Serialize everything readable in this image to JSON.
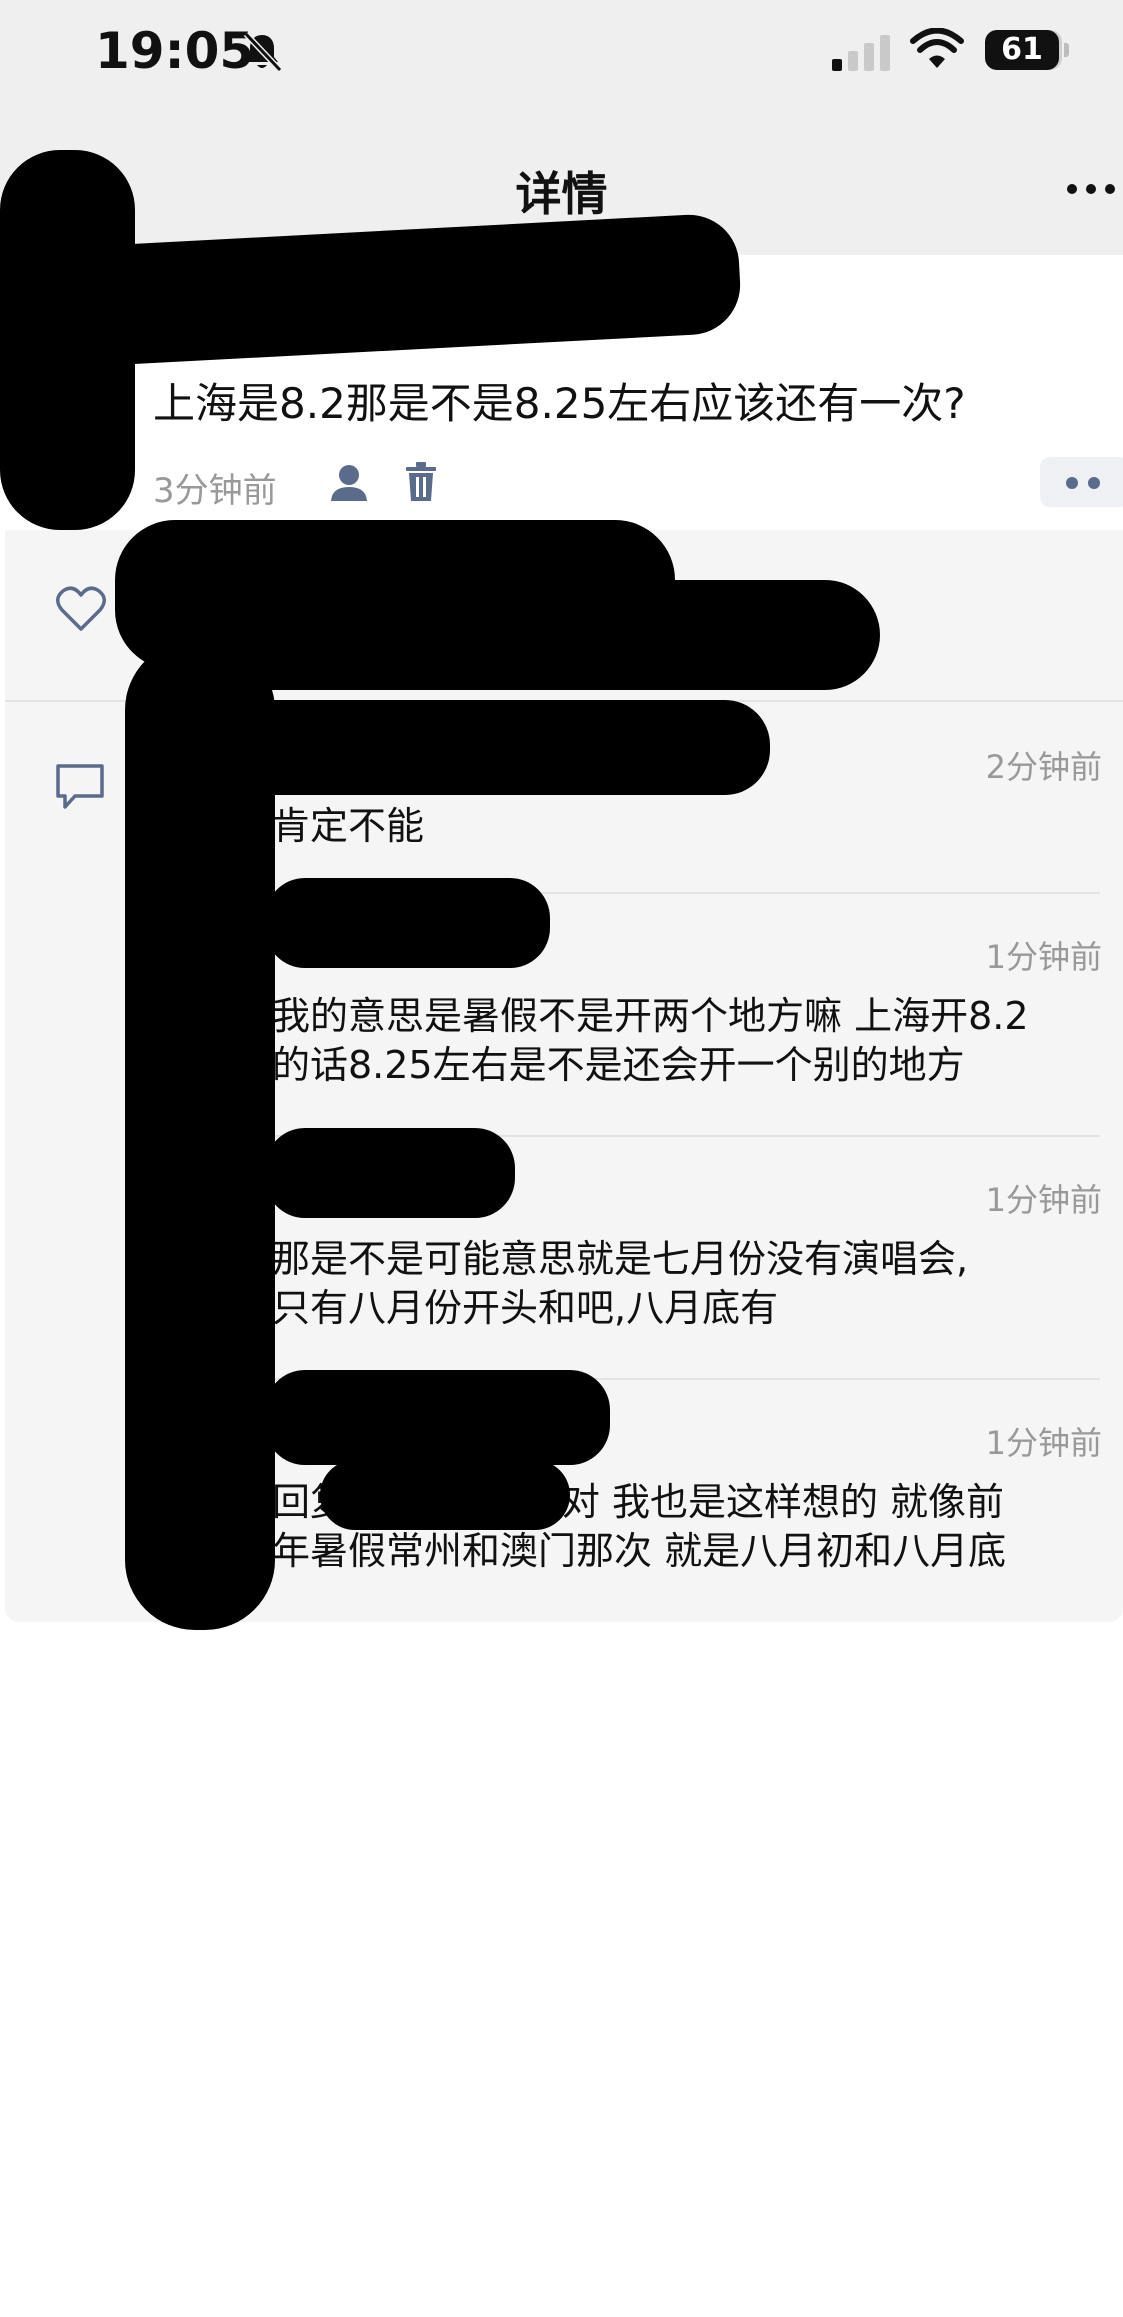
{
  "status_bar": {
    "time": "19:05",
    "battery": "61",
    "icons": [
      "bell-off-icon",
      "signal-icon",
      "wifi-icon",
      "battery-icon"
    ]
  },
  "nav": {
    "title": "详情",
    "icons": [
      "back-icon",
      "more-icon"
    ]
  },
  "post": {
    "text": "上海是8.2那是不是8.25左右应该还有一次?",
    "time": "3分钟前",
    "icons": [
      "user-icon",
      "trash-icon",
      "more-dots-icon"
    ]
  },
  "comments_section": {
    "icons": [
      "heart-icon",
      "comment-icon"
    ],
    "comments": [
      {
        "time": "2分钟前",
        "lines": [
          "肯定不能"
        ]
      },
      {
        "time": "1分钟前",
        "lines": [
          "我的意思是暑假不是开两个地方嘛 上海开8.2",
          "的话8.25左右是不是还会开一个别的地方"
        ]
      },
      {
        "time": "1分钟前",
        "lines": [
          "那是不是可能意思就是七月份没有演唱会,",
          "只有八月份开头和吧,八月底有"
        ]
      },
      {
        "time": "1分钟前",
        "lines": [
          "回复7777777^:对 我也是这样想的 就像前",
          "年暑假常州和澳门那次 就是八月初和八月底"
        ]
      }
    ]
  },
  "colors": {
    "background": "#ffffff",
    "header_bg": "#efefef",
    "panel_bg": "#f5f5f5",
    "icon_accent": "#5b6b8c",
    "muted_text": "#999999"
  }
}
